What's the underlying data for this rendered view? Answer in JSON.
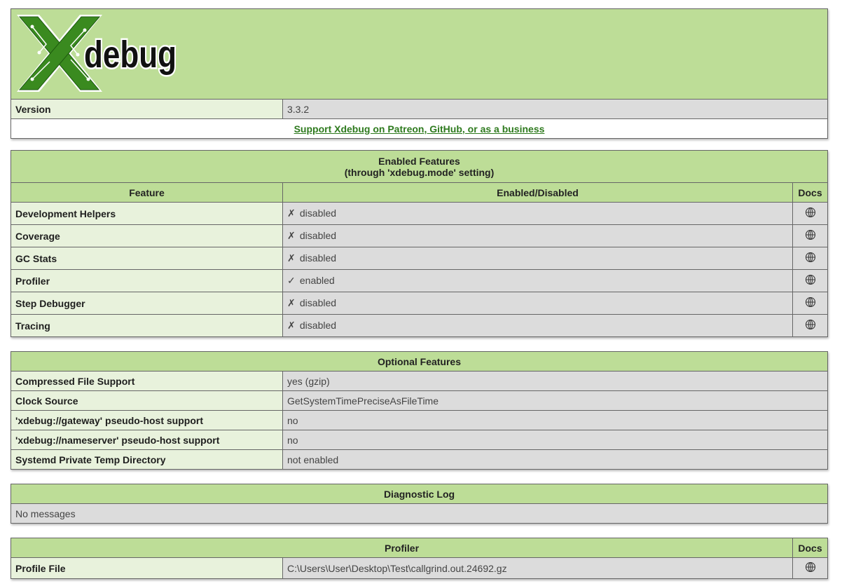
{
  "header": {
    "logo_text": "Xdebug",
    "version_label": "Version",
    "version_value": "3.3.2",
    "support_link": "Support Xdebug on Patreon, GitHub, or as a business"
  },
  "enabled_features": {
    "title_line1": "Enabled Features",
    "title_line2": "(through 'xdebug.mode' setting)",
    "col_feature": "Feature",
    "col_status": "Enabled/Disabled",
    "col_docs": "Docs",
    "docs_icon": "globe-icon",
    "rows": [
      {
        "feature": "Development Helpers",
        "mark": "✗",
        "status": "disabled"
      },
      {
        "feature": "Coverage",
        "mark": "✗",
        "status": "disabled"
      },
      {
        "feature": "GC Stats",
        "mark": "✗",
        "status": "disabled"
      },
      {
        "feature": "Profiler",
        "mark": "✓",
        "status": "enabled"
      },
      {
        "feature": "Step Debugger",
        "mark": "✗",
        "status": "disabled"
      },
      {
        "feature": "Tracing",
        "mark": "✗",
        "status": "disabled"
      }
    ]
  },
  "optional_features": {
    "title": "Optional Features",
    "rows": [
      {
        "name": "Compressed File Support",
        "value": "yes (gzip)"
      },
      {
        "name": "Clock Source",
        "value": "GetSystemTimePreciseAsFileTime"
      },
      {
        "name": "'xdebug://gateway' pseudo-host support",
        "value": "no"
      },
      {
        "name": "'xdebug://nameserver' pseudo-host support",
        "value": "no"
      },
      {
        "name": "Systemd Private Temp Directory",
        "value": "not enabled"
      }
    ]
  },
  "diagnostic_log": {
    "title": "Diagnostic Log",
    "message": "No messages"
  },
  "profiler": {
    "title": "Profiler",
    "col_docs": "Docs",
    "row_label": "Profile File",
    "row_value": "C:\\Users\\User\\Desktop\\Test\\callgrind.out.24692.gz"
  },
  "colors": {
    "header_green": "#bddd97",
    "label_green": "#e8f2dc",
    "value_gray": "#dcdcdc",
    "link_green": "#2e7a1e"
  }
}
